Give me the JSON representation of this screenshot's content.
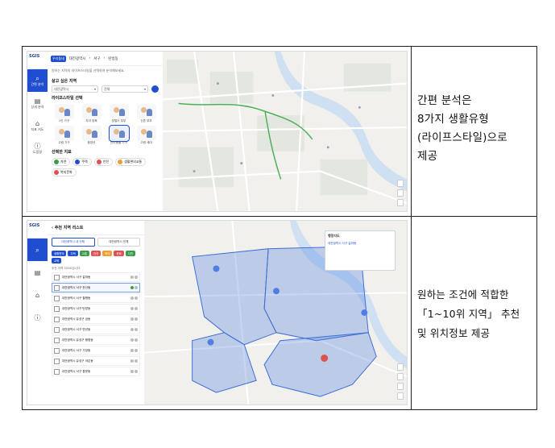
{
  "rows": [
    {
      "description_lines": [
        "간편 분석은",
        "8가지 생활유형",
        "(라이프스타일)으로",
        "제공"
      ],
      "screenshot": {
        "logo": "SGIS",
        "header_badge": "우리동네",
        "breadcrumb": [
          "대전광역시",
          "서구",
          "탄방동"
        ],
        "rail": [
          {
            "label": "간편 분석",
            "icon": "search-icon",
            "active": true
          },
          {
            "label": "상세 분석",
            "icon": "document-icon",
            "active": false
          },
          {
            "label": "지표 지도",
            "icon": "house-icon",
            "active": false
          },
          {
            "label": "도움말",
            "icon": "info-icon",
            "active": false
          }
        ],
        "intro_text": "원하는 지역의 라이프스타일을 선택하여 분석해보세요.",
        "region_label": "살고 싶은 지역",
        "region_select": [
          "대전광역시",
          "전체"
        ],
        "lifestyle_label": "라이프스타일 선택",
        "lifestyles": [
          "1인 가구",
          "자녀 양육",
          "맞벌이 부부",
          "신혼 부부",
          "고령 가구",
          "중장년",
          "반려동물 가구",
          "고령 세대"
        ],
        "selected_lifestyle_index": 6,
        "indicator_label": "선택한 지표",
        "indicators": [
          {
            "label": "자연",
            "color": "#3a9b4a"
          },
          {
            "label": "주택",
            "color": "#1f4fd0"
          },
          {
            "label": "안전",
            "color": "#e05252"
          },
          {
            "label": "생활편의교통",
            "color": "#f0a030"
          },
          {
            "label": "복지문화",
            "color": "#e05252"
          }
        ]
      }
    },
    {
      "description_lines": [
        "원하는 조건에 적합한",
        "「1~10위 지역」 추천",
        "및 위치정보 제공"
      ],
      "screenshot": {
        "logo": "SGIS",
        "list_title": "추천 지역 리스트",
        "tabs": [
          "대전광역시 내 전체",
          "대전광역시 전체"
        ],
        "tags": [
          {
            "label": "생활편의",
            "color": "#1f4fd0"
          },
          {
            "label": "주택",
            "color": "#1f4fd0"
          },
          {
            "label": "교통",
            "color": "#3a9b4a"
          },
          {
            "label": "안전",
            "color": "#e05252"
          },
          {
            "label": "복지",
            "color": "#f0a030"
          },
          {
            "label": "문화",
            "color": "#e05252"
          },
          {
            "label": "자연",
            "color": "#3a9b4a"
          },
          {
            "label": "교육",
            "color": "#1f4fd0"
          }
        ],
        "rank_note": "추천 지역 리스트입니다.",
        "ranks": [
          "대전광역시 서구 갈마동",
          "대전광역시 서구 둔산동",
          "대전광역시 서구 월평동",
          "대전광역시 서구 탄방동",
          "대전광역시 유성구 궁동",
          "대전광역시 서구 만년동",
          "대전광역시 유성구 봉명동",
          "대전광역시 서구 가장동",
          "대전광역시 유성구 어은동",
          "대전광역시 서구 용문동"
        ],
        "selected_rank_index": 1,
        "popup_title": "행정지도",
        "popup_text": "대전광역시 서구 갈마동"
      }
    }
  ]
}
